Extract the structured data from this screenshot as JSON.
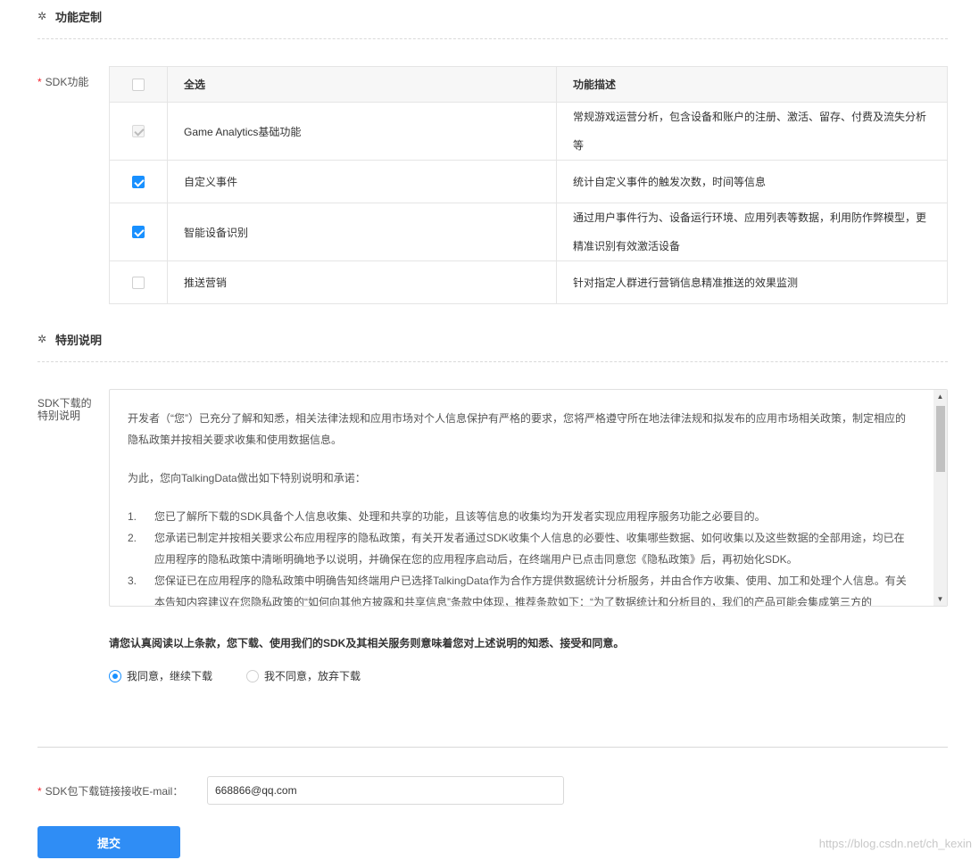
{
  "sections": {
    "feature_custom": "功能定制",
    "special_notes": "特别说明"
  },
  "form": {
    "sdk_feature_label": "SDK功能",
    "sdk_notes_label_line1": "SDK下载的",
    "sdk_notes_label_line2": "特别说明",
    "email_label": "SDK包下载链接接收E-mail：",
    "email_value": "668866@qq.com",
    "submit_label": "提交"
  },
  "table": {
    "headers": [
      "全选",
      "功能描述"
    ],
    "rows": [
      {
        "name": "Game Analytics基础功能",
        "desc": "常规游戏运营分析，包含设备和账户的注册、激活、留存、付费及流失分析等",
        "state": "disabled-checked"
      },
      {
        "name": "自定义事件",
        "desc": "统计自定义事件的触发次数，时间等信息",
        "state": "checked"
      },
      {
        "name": "智能设备识别",
        "desc": "通过用户事件行为、设备运行环境、应用列表等数据，利用防作弊模型，更精准识别有效激活设备",
        "state": "checked"
      },
      {
        "name": "推送营销",
        "desc": "针对指定人群进行营销信息精准推送的效果监测",
        "state": "unchecked"
      }
    ]
  },
  "notice": {
    "para1": "开发者（“您”）已充分了解和知悉，相关法律法规和应用市场对个人信息保护有严格的要求，您将严格遵守所在地法律法规和拟发布的应用市场相关政策，制定相应的隐私政策并按相关要求收集和使用数据信息。",
    "para2": "为此，您向TalkingData做出如下特别说明和承诺：",
    "items": [
      {
        "num": "1.",
        "text": "您已了解所下载的SDK具备个人信息收集、处理和共享的功能，且该等信息的收集均为开发者实现应用程序服务功能之必要目的。"
      },
      {
        "num": "2.",
        "text": "您承诺已制定并按相关要求公布应用程序的隐私政策，有关开发者通过SDK收集个人信息的必要性、收集哪些数据、如何收集以及这些数据的全部用途，均已在应用程序的隐私政策中清晰明确地予以说明，并确保在您的应用程序启动后，在终端用户已点击同意您《隐私政策》后，再初始化SDK。"
      },
      {
        "num": "3.",
        "text": "您保证已在应用程序的隐私政策中明确告知终端用户已选择TalkingData作为合作方提供数据统计分析服务，并由合作方收集、使用、加工和处理个人信息。有关本告知内容建议在您隐私政策的“如何向其他方披露和共享信息”条款中体现，推荐条款如下：“为了数据统计和分析目的，我们的产品可能会集成第三方的"
      }
    ]
  },
  "agreement": {
    "statement": "请您认真阅读以上条款，您下载、使用我们的SDK及其相关服务则意味着您对上述说明的知悉、接受和同意。",
    "agree_option": "我同意，继续下载",
    "disagree_option": "我不同意，放弃下载",
    "selected": "agree"
  },
  "watermark": "https://blog.csdn.net/ch_kexin",
  "colors": {
    "accent": "#1890ff",
    "button": "#2f8df5",
    "required": "#f5222d"
  }
}
